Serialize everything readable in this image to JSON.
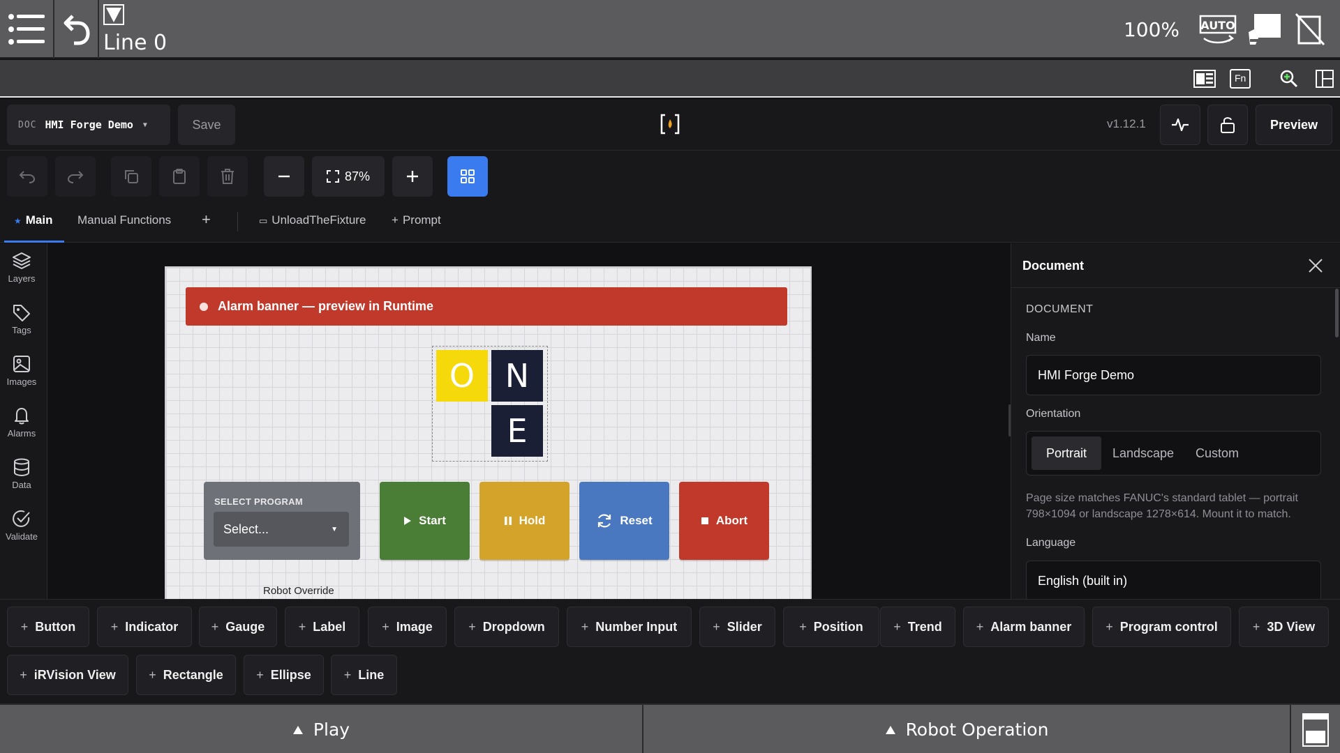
{
  "topbar": {
    "line_label": "Line 0",
    "override_pct": "100%",
    "icons": [
      "menu-icon",
      "undo-back-icon",
      "dropdown-triangle-icon",
      "auto-mode-icon",
      "teach-pendant-icon",
      "no-signal-icon"
    ]
  },
  "subbar": {
    "fn_label": "Fn",
    "icons": [
      "screen-layout-icon",
      "fn-key-icon",
      "zoom-in-icon",
      "split-view-icon"
    ]
  },
  "editor": {
    "doc_prefix": "DOC",
    "doc_name": "HMI Forge Demo",
    "save_label": "Save",
    "version": "v1.12.1",
    "preview_label": "Preview"
  },
  "toolbar": {
    "zoom_level": "87%",
    "icons": [
      "undo-icon",
      "redo-icon",
      "copy-icon",
      "paste-icon",
      "delete-icon",
      "zoom-out-icon",
      "fit-icon",
      "zoom-in-icon",
      "grid-icon"
    ]
  },
  "tabs": {
    "main": "Main",
    "manual": "Manual Functions",
    "unload": "UnloadTheFixture",
    "prompt": "Prompt",
    "add_symbol": "+"
  },
  "rail": {
    "layers": "Layers",
    "tags": "Tags",
    "images": "Images",
    "alarms": "Alarms",
    "data": "Data",
    "validate": "Validate"
  },
  "canvas": {
    "alarm_text": "Alarm banner — preview in Runtime",
    "logo": {
      "o": "O",
      "n": "N",
      "e": "E"
    },
    "select_program_caption": "SELECT PROGRAM",
    "select_placeholder": "Select...",
    "buttons": {
      "start": "Start",
      "hold": "Hold",
      "reset": "Reset",
      "abort": "Abort"
    },
    "override_label": "Robot Override",
    "colors": {
      "alarm": "#c0392b",
      "start": "#4a7d35",
      "hold": "#d4a32a",
      "reset": "#4a78c0",
      "abort": "#c0392b",
      "logo_yellow": "#f5d90a",
      "logo_navy": "#1b1f36"
    }
  },
  "panel": {
    "title": "Document",
    "section": "DOCUMENT",
    "name_label": "Name",
    "name_value": "HMI Forge Demo",
    "orientation_label": "Orientation",
    "orientation_options": [
      "Portrait",
      "Landscape",
      "Custom"
    ],
    "orientation_selected": "Portrait",
    "note": "Page size matches FANUC's standard tablet — portrait 798×1094 or landscape 1278×614. Mount it to match.",
    "language_label": "Language",
    "language_value": "English (built in)"
  },
  "palette": {
    "items": [
      "Button",
      "Indicator",
      "Gauge",
      "Label",
      "Image",
      "Dropdown",
      "Number Input",
      "Slider",
      "Position",
      "Trend",
      "Alarm banner",
      "Program control",
      "3D View",
      "iRVision View",
      "Rectangle",
      "Ellipse",
      "Line"
    ]
  },
  "bottombar": {
    "play": "Play",
    "robot_operation": "Robot Operation"
  }
}
